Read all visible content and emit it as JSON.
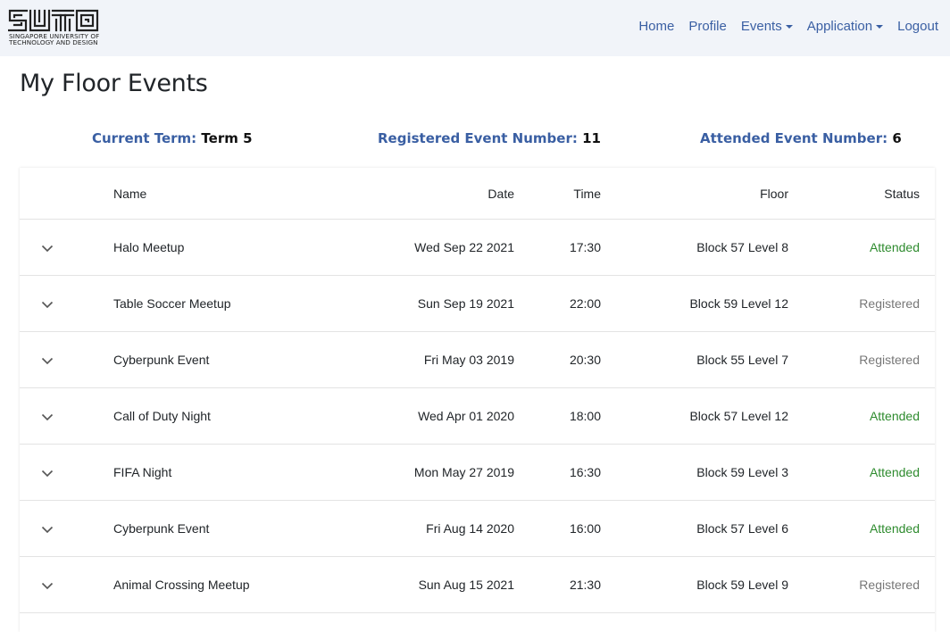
{
  "logo": {
    "text_line1": "SINGAPORE UNIVERSITY OF",
    "text_line2": "TECHNOLOGY AND DESIGN"
  },
  "nav": {
    "home": "Home",
    "profile": "Profile",
    "events": "Events",
    "application": "Application",
    "logout": "Logout"
  },
  "page": {
    "title": "My Floor Events"
  },
  "stats": {
    "term_label": "Current Term:",
    "term_value": "Term 5",
    "registered_label": "Registered Event Number:",
    "registered_value": "11",
    "attended_label": "Attended Event Number:",
    "attended_value": "6"
  },
  "table": {
    "headers": {
      "name": "Name",
      "date": "Date",
      "time": "Time",
      "floor": "Floor",
      "status": "Status"
    },
    "rows": [
      {
        "name": "Halo Meetup",
        "date": "Wed Sep 22 2021",
        "time": "17:30",
        "floor": "Block 57 Level 8",
        "status": "Attended"
      },
      {
        "name": "Table Soccer Meetup",
        "date": "Sun Sep 19 2021",
        "time": "22:00",
        "floor": "Block 59 Level 12",
        "status": "Registered"
      },
      {
        "name": "Cyberpunk Event",
        "date": "Fri May 03 2019",
        "time": "20:30",
        "floor": "Block 55 Level 7",
        "status": "Registered"
      },
      {
        "name": "Call of Duty Night",
        "date": "Wed Apr 01 2020",
        "time": "18:00",
        "floor": "Block 57 Level 12",
        "status": "Attended"
      },
      {
        "name": "FIFA Night",
        "date": "Mon May 27 2019",
        "time": "16:30",
        "floor": "Block 59 Level 3",
        "status": "Attended"
      },
      {
        "name": "Cyberpunk Event",
        "date": "Fri Aug 14 2020",
        "time": "16:00",
        "floor": "Block 57 Level 6",
        "status": "Attended"
      },
      {
        "name": "Animal Crossing Meetup",
        "date": "Sun Aug 15 2021",
        "time": "21:30",
        "floor": "Block 59 Level 9",
        "status": "Registered"
      }
    ]
  },
  "colors": {
    "navbar_bg": "#f1f4f9",
    "link": "#3a5fa3",
    "attended": "#2e8b2e",
    "registered": "#777777"
  }
}
